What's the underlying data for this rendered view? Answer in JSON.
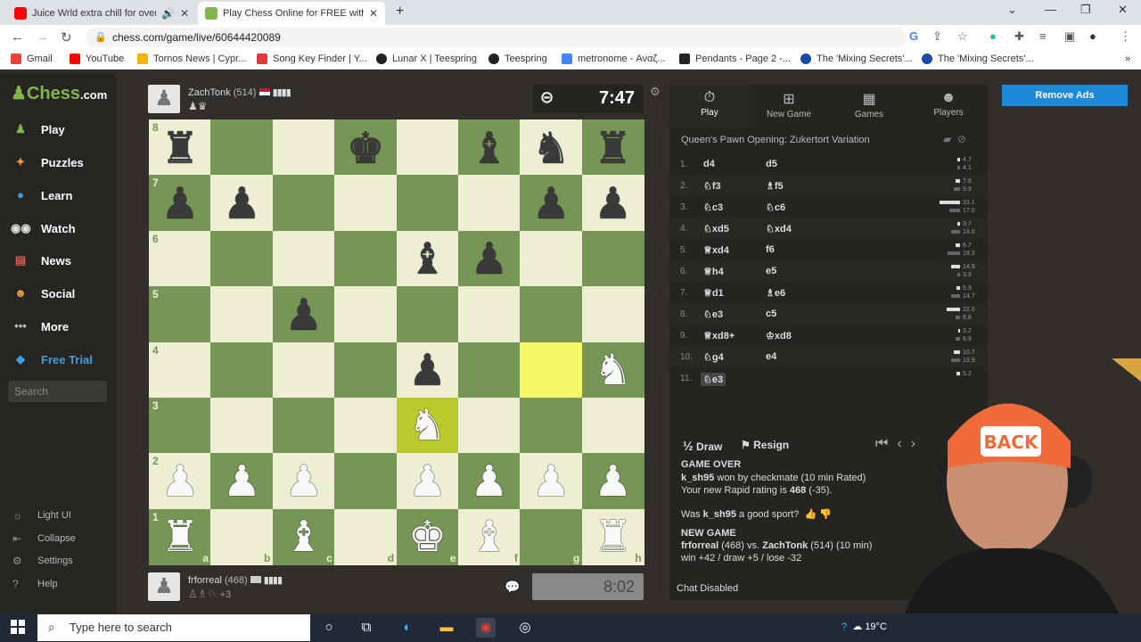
{
  "browser": {
    "tabs": [
      {
        "title": "Juice Wrld extra chill for over",
        "favicon_color": "#ff0000",
        "audio_icon": "speaker-icon"
      },
      {
        "title": "Play Chess Online for FREE with F",
        "favicon_color": "#81b64c"
      }
    ],
    "url": "chess.com/game/live/60644420089",
    "bookmarks": [
      {
        "label": "Gmail",
        "color": "#ea4335"
      },
      {
        "label": "YouTube",
        "color": "#ff0000"
      },
      {
        "label": "Tornos News | Cypr...",
        "color": "#f4b400"
      },
      {
        "label": "Song Key Finder | Y...",
        "color": "#e53935"
      },
      {
        "label": "Lunar X | Teespring",
        "color": "#222222"
      },
      {
        "label": "Teespring",
        "color": "#222222"
      },
      {
        "label": "metronome - Αναζ...",
        "color": "#4285f4"
      },
      {
        "label": "Pendants - Page 2 -...",
        "color": "#222222"
      },
      {
        "label": "The 'Mixing Secrets'...",
        "color": "#1a4aa8"
      },
      {
        "label": "The 'Mixing Secrets'...",
        "color": "#1a4aa8"
      }
    ]
  },
  "sidebar": {
    "logo_a": "",
    "logo_b": "Chess",
    "logo_c": ".com",
    "items": [
      {
        "label": "Play",
        "icon": "pawn-icon",
        "color": "#81b64c"
      },
      {
        "label": "Puzzles",
        "icon": "puzzle-icon",
        "color": "#f7913d"
      },
      {
        "label": "Learn",
        "icon": "graduation-cap-icon",
        "color": "#3b9fe0"
      },
      {
        "label": "Watch",
        "icon": "binoculars-icon",
        "color": "#dddddd"
      },
      {
        "label": "News",
        "icon": "newspaper-icon",
        "color": "#e05a4a"
      },
      {
        "label": "Social",
        "icon": "people-icon",
        "color": "#e8a24a"
      },
      {
        "label": "More",
        "icon": "dots-icon",
        "color": "#bbbbbb"
      },
      {
        "label": "Free Trial",
        "icon": "diamond-icon",
        "color": "#3b9fe0"
      }
    ],
    "search_placeholder": "Search",
    "bottom": [
      {
        "label": "Light UI",
        "icon": "sun-icon"
      },
      {
        "label": "Collapse",
        "icon": "collapse-icon"
      },
      {
        "label": "Settings",
        "icon": "gear-icon"
      },
      {
        "label": "Help",
        "icon": "help-icon"
      }
    ]
  },
  "top_player": {
    "name": "ZachTonk",
    "rating": "(514)",
    "captured": "♟♛",
    "clock": "7:47"
  },
  "bottom_player": {
    "name": "frforreal",
    "rating": "(468)",
    "captured": "♙♗♘",
    "advantage": "+3",
    "clock": "8:02"
  },
  "board": {
    "light": "#eeeed2",
    "dark": "#769656",
    "highlight_light": "#f6f669",
    "highlight_dark": "#baca2b",
    "ranks": [
      "8",
      "7",
      "6",
      "5",
      "4",
      "3",
      "2",
      "1"
    ],
    "files": [
      "a",
      "b",
      "c",
      "d",
      "e",
      "f",
      "g",
      "h"
    ],
    "rows": [
      [
        "r",
        "",
        "",
        "k",
        "",
        "b",
        "n",
        "r"
      ],
      [
        "p",
        "p",
        "",
        "",
        "",
        "",
        "p",
        "p"
      ],
      [
        "",
        "",
        "",
        "",
        "b",
        "p",
        "",
        ""
      ],
      [
        "",
        "",
        "p",
        "",
        "",
        "",
        "",
        ""
      ],
      [
        "",
        "",
        "",
        "",
        "p",
        "",
        "",
        "N"
      ],
      [
        "",
        "",
        "",
        "",
        "N",
        "",
        "",
        ""
      ],
      [
        "P",
        "P",
        "P",
        "",
        "P",
        "P",
        "P",
        "P"
      ],
      [
        "R",
        "",
        "B",
        "",
        "K",
        "B",
        "",
        "R"
      ]
    ],
    "highlighted": [
      "g4",
      "e3"
    ]
  },
  "panel": {
    "tabs": [
      {
        "label": "Play",
        "icon": "stopwatch-icon"
      },
      {
        "label": "New Game",
        "icon": "plus-icon"
      },
      {
        "label": "Games",
        "icon": "board-icon"
      },
      {
        "label": "Players",
        "icon": "players-icon"
      }
    ],
    "opening": "Queen's Pawn Opening: Zukertort Variation",
    "moves": [
      {
        "n": "1.",
        "w": "d4",
        "b": "d5",
        "t1": "4.7",
        "t2": "4.1"
      },
      {
        "n": "2.",
        "w": "♘f3",
        "b": "♗f5",
        "t1": "7.8",
        "t2": "9.9"
      },
      {
        "n": "3.",
        "w": "♘c3",
        "b": "♘c6",
        "t1": "33.1",
        "t2": "17.0"
      },
      {
        "n": "4.",
        "w": "♘xd5",
        "b": "♘xd4",
        "t1": "3.7",
        "t2": "14.0"
      },
      {
        "n": "5.",
        "w": "♕xd4",
        "b": "f6",
        "t1": "6.7",
        "t2": "19.3"
      },
      {
        "n": "6.",
        "w": "♕h4",
        "b": "e5",
        "t1": "14.9",
        "t2": "3.9"
      },
      {
        "n": "7.",
        "w": "♕d1",
        "b": "♗e6",
        "t1": "5.9",
        "t2": "14.7"
      },
      {
        "n": "8.",
        "w": "♘e3",
        "b": "c5",
        "t1": "22.0",
        "t2": "6.8"
      },
      {
        "n": "9.",
        "w": "♕xd8+",
        "b": "♔xd8",
        "t1": "3.2",
        "t2": "6.9"
      },
      {
        "n": "10.",
        "w": "♘g4",
        "b": "e4",
        "t1": "10.7",
        "t2": "13.9"
      },
      {
        "n": "11.",
        "w": "♘e3",
        "b": "",
        "t1": "5.2",
        "t2": ""
      }
    ],
    "draw": "Draw",
    "draw_icon": "½",
    "resign": "Resign",
    "game_over": "GAME OVER",
    "result_player": "k_sh95",
    "result_text": " won by checkmate (10 min Rated)",
    "rating_text": "Your new Rapid rating is ",
    "rating_value": "468",
    "rating_change": " (-35).",
    "sport_q_a": "Was ",
    "sport_q_b": "k_sh95",
    "sport_q_c": " a good sport?",
    "new_game": "NEW GAME",
    "ng_line_a": "frforreal",
    "ng_line_b": " (468) vs. ",
    "ng_line_c": "ZachTonk",
    "ng_line_d": " (514) (10 min)",
    "record": "win +42 / draw +5 / lose -32",
    "chat": "Chat Disabled"
  },
  "remove_ads": "Remove Ads",
  "taskbar": {
    "search": "Type here to search",
    "weather": "19°C"
  }
}
